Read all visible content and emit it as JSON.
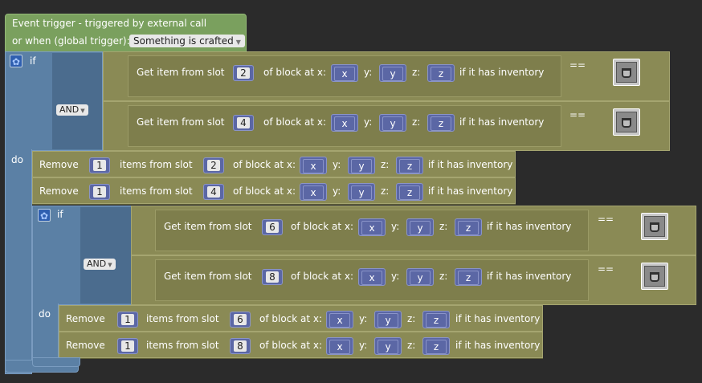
{
  "event": {
    "line1": "Event trigger - triggered by external call",
    "line2": "or when (global trigger):",
    "trigger_option": "Something is crafted"
  },
  "labels": {
    "if": "if",
    "do": "do",
    "and": "AND",
    "eq": "==",
    "get_item": "Get item from slot",
    "of_block": "of block at x:",
    "y": "y:",
    "z": "z:",
    "has_inv": "if it has inventory",
    "remove": "Remove",
    "items_from": "items from slot",
    "var_x": "x",
    "var_y": "y",
    "var_z": "z"
  },
  "outer_if": {
    "cond1_slot": "2",
    "cond2_slot": "4",
    "remove1": {
      "count": "1",
      "slot": "2"
    },
    "remove2": {
      "count": "1",
      "slot": "4"
    }
  },
  "inner_if": {
    "cond1_slot": "6",
    "cond2_slot": "8",
    "remove1": {
      "count": "1",
      "slot": "6"
    },
    "remove2": {
      "count": "1",
      "slot": "8"
    }
  },
  "icons": {
    "gear": "gear-icon",
    "item": "bucket-icon"
  }
}
